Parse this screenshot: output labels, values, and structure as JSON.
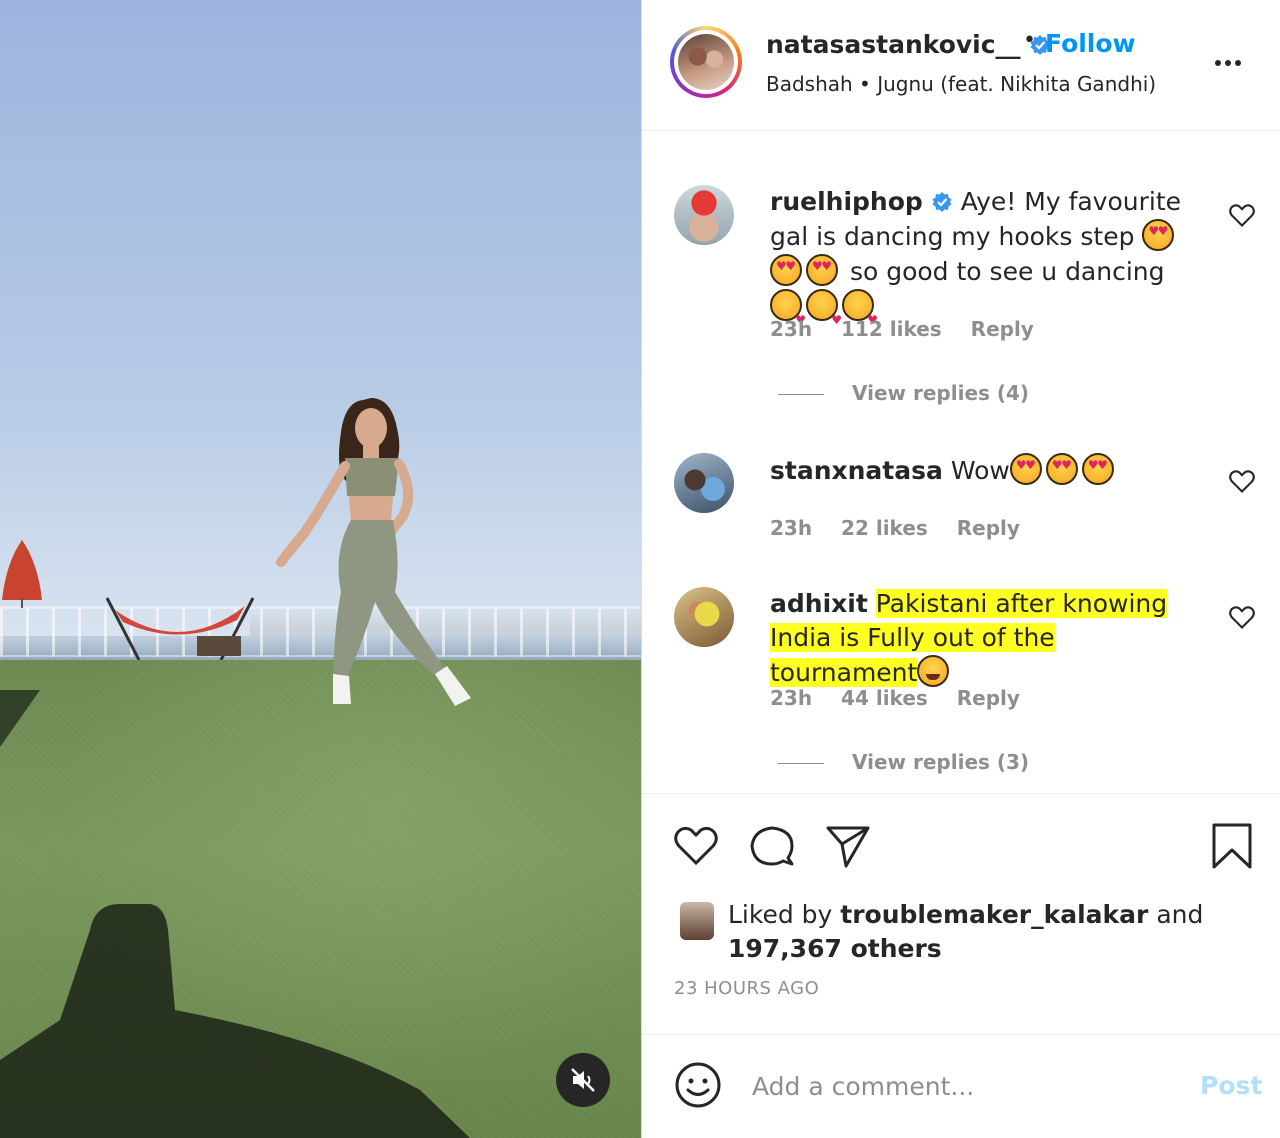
{
  "header": {
    "username": "natasastankovic__",
    "verified": true,
    "dot": "•",
    "follow_label": "Follow",
    "song": "Badshah • Jugnu (feat. Nikhita Gandhi)",
    "more_icon": "more-horizontal-icon"
  },
  "comments": [
    {
      "username": "ruelhiphop",
      "verified": true,
      "text_before": "Aye! My favourite gal is dancing my hooks step",
      "text_after": "so good to see u dancing",
      "emojis_1": [
        "heart-eyes",
        "heart-eyes",
        "heart-eyes"
      ],
      "emojis_2": [
        "kiss",
        "kiss",
        "kiss"
      ],
      "time": "23h",
      "likes": "112 likes",
      "reply_label": "Reply",
      "view_replies": "View replies (4)"
    },
    {
      "username": "stanxnatasa",
      "text": "Wow",
      "emojis": [
        "heart-eyes",
        "heart-eyes",
        "heart-eyes"
      ],
      "time": "23h",
      "likes": "22 likes",
      "reply_label": "Reply"
    },
    {
      "username": "adhixit",
      "text": "Pakistani after knowing India is Fully out of the tournament",
      "highlight_color": "#ffff22",
      "emojis": [
        "laugh"
      ],
      "time": "23h",
      "likes": "44 likes",
      "reply_label": "Reply",
      "view_replies": "View replies (3)"
    }
  ],
  "actions": {
    "liked_prefix": "Liked by",
    "liked_user": "troublemaker_kalakar",
    "liked_suffix": "and",
    "liked_others": "197,367 others",
    "post_time": "23 HOURS AGO"
  },
  "add_comment": {
    "placeholder": "Add a comment...",
    "post_label": "Post"
  },
  "media": {
    "mute_icon": "volume-muted-icon"
  },
  "colors": {
    "accent": "#0095f6",
    "post_disabled": "#b2dffc",
    "muted_text": "#8e8e8e"
  }
}
